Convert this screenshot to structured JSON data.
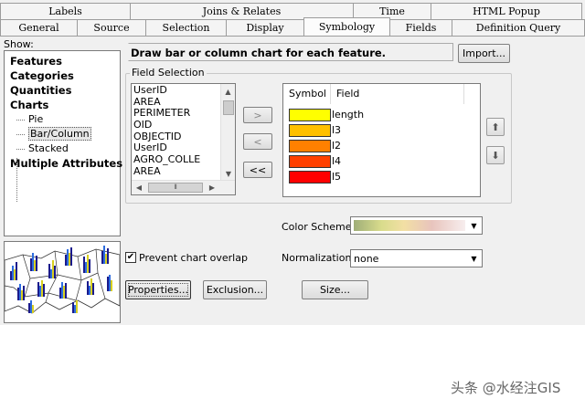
{
  "tabs_row1": [
    "Labels",
    "Joins & Relates",
    "Time",
    "HTML Popup"
  ],
  "tabs_row2": [
    "General",
    "Source",
    "Selection",
    "Display",
    "Symbology",
    "Fields",
    "Definition Query"
  ],
  "active_tab": "Symbology",
  "show_label": "Show:",
  "tree": {
    "features": "Features",
    "categories": "Categories",
    "quantities": "Quantities",
    "charts": "Charts",
    "pie": "Pie",
    "bar_column": "Bar/Column",
    "stacked": "Stacked",
    "multiple_attributes": "Multiple Attributes"
  },
  "description": "Draw bar or column chart for each feature.",
  "import_button": "Import...",
  "field_selection_title": "Field Selection",
  "available_fields": [
    "UserID",
    "AREA",
    "PERIMETER",
    "OID",
    "OBJECTID",
    "UserID",
    "AGRO_COLLE",
    "AREA"
  ],
  "move_buttons": {
    "add": ">",
    "remove": "<",
    "remove_all": "<<"
  },
  "table_headers": {
    "symbol": "Symbol",
    "field": "Field"
  },
  "selected_fields": [
    {
      "name": "length",
      "color": "#ffff00"
    },
    {
      "name": "l3",
      "color": "#ffc000"
    },
    {
      "name": "l2",
      "color": "#ff8000"
    },
    {
      "name": "l4",
      "color": "#ff4000"
    },
    {
      "name": "l5",
      "color": "#ff0000"
    }
  ],
  "color_scheme_label": "Color Scheme:",
  "prevent_overlap_label": "Prevent chart overlap",
  "prevent_overlap_checked": true,
  "normalization_label": "Normalization:",
  "normalization_value": "none",
  "properties_button": "Properties...",
  "exclusion_button": "Exclusion...",
  "size_button": "Size...",
  "watermark": "头条 @水经注GIS"
}
